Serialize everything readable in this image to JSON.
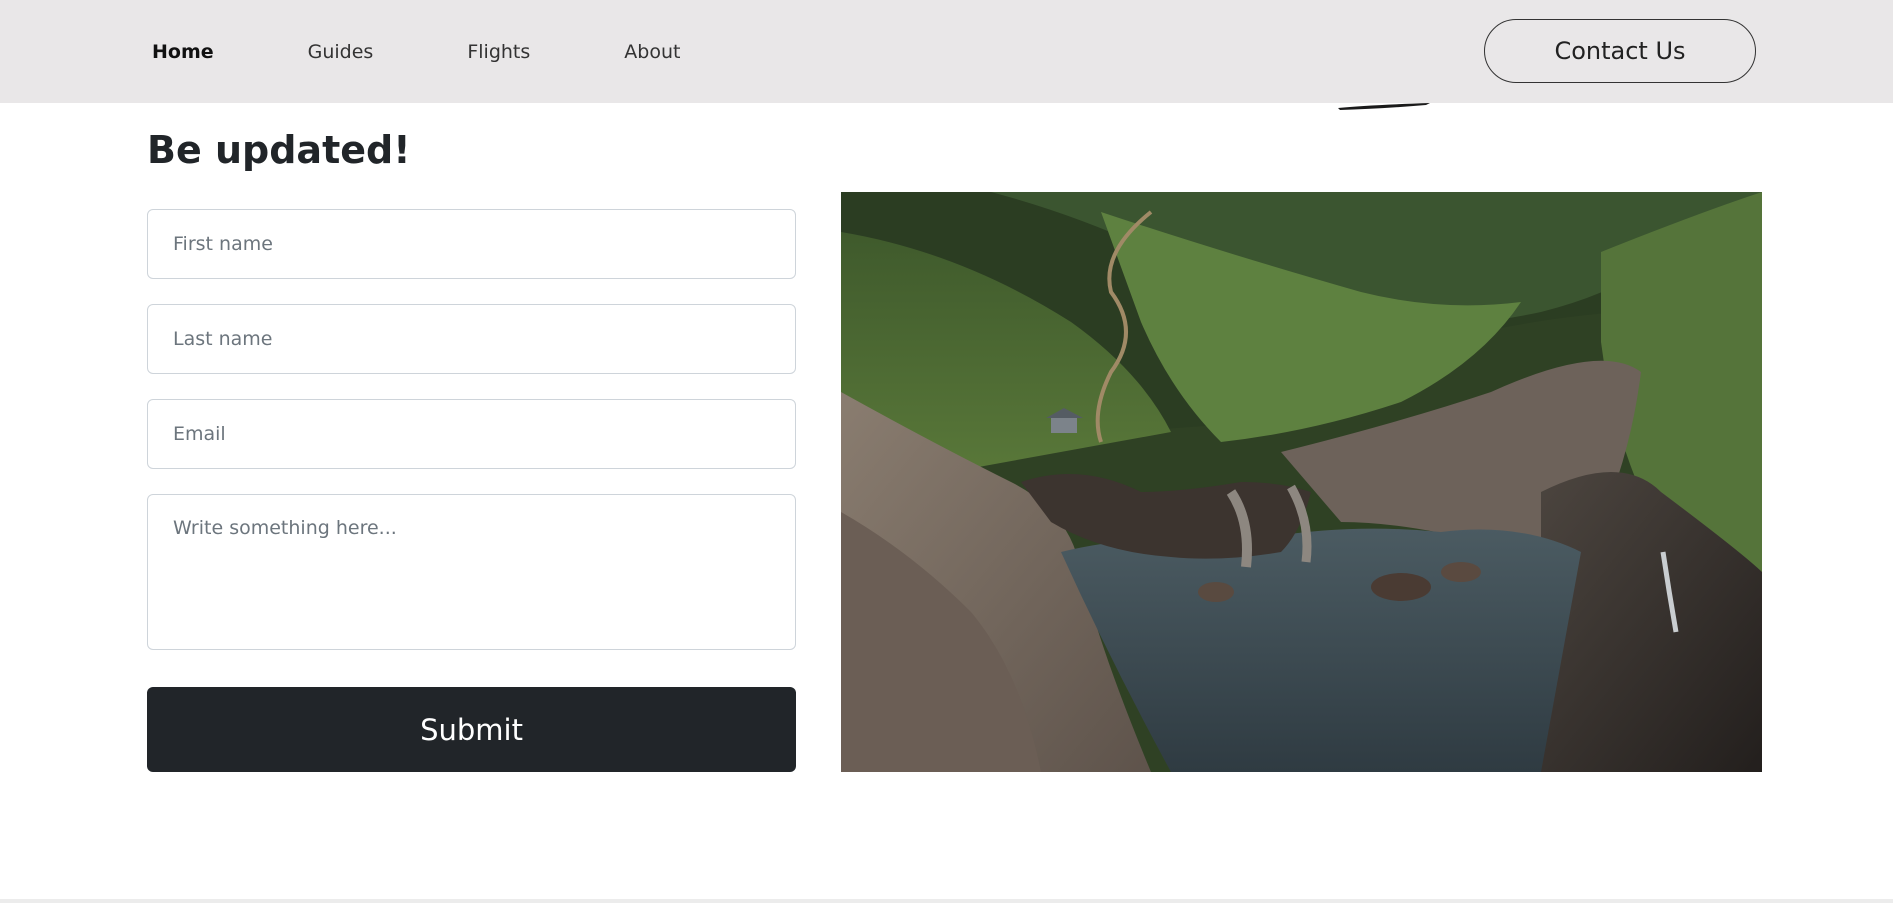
{
  "nav": {
    "links": [
      {
        "label": "Home",
        "active": true
      },
      {
        "label": "Guides",
        "active": false
      },
      {
        "label": "Flights",
        "active": false
      },
      {
        "label": "About",
        "active": false
      }
    ],
    "contact_label": "Contact Us"
  },
  "form": {
    "title": "Be updated!",
    "first_name_placeholder": "First name",
    "last_name_placeholder": "Last name",
    "email_placeholder": "Email",
    "message_placeholder": "Write something here...",
    "submit_label": "Submit"
  },
  "photo": {
    "subject": "coastal-cove-landscape"
  },
  "colors": {
    "navbar_bg": "#e9e7e8",
    "button_dark": "#212529",
    "text_dark": "#212529",
    "placeholder": "#6c757d",
    "field_border": "#ced4da"
  }
}
